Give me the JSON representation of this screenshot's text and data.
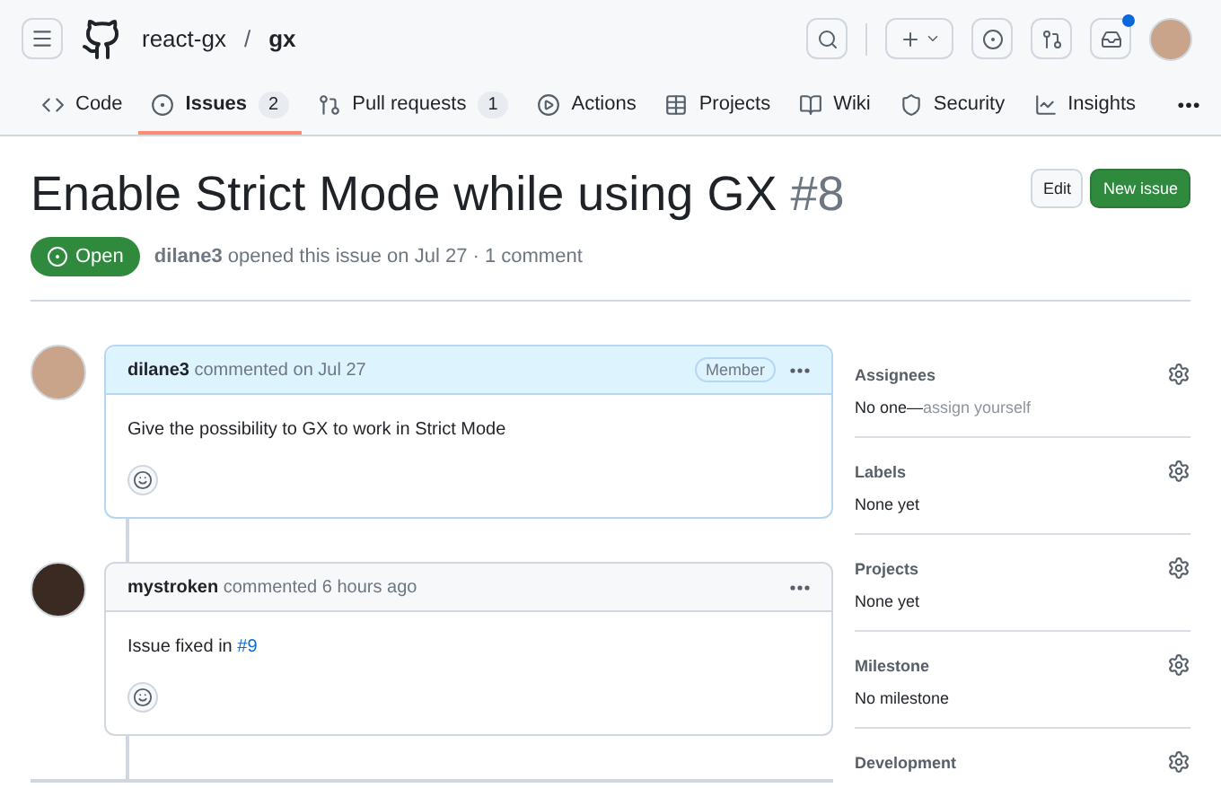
{
  "header": {
    "owner": "react-gx",
    "separator": "/",
    "repo": "gx",
    "unread_notifications": true
  },
  "tabs": [
    {
      "label": "Code",
      "selected": false
    },
    {
      "label": "Issues",
      "count": "2",
      "selected": true
    },
    {
      "label": "Pull requests",
      "count": "1",
      "selected": false
    },
    {
      "label": "Actions",
      "selected": false
    },
    {
      "label": "Projects",
      "selected": false
    },
    {
      "label": "Wiki",
      "selected": false
    },
    {
      "label": "Security",
      "selected": false
    },
    {
      "label": "Insights",
      "selected": false
    }
  ],
  "issue": {
    "title": "Enable Strict Mode while using GX",
    "number": "#8",
    "state": "Open",
    "author": "dilane3",
    "meta": "opened this issue on Jul 27 · 1 comment",
    "buttons": [
      "Edit",
      "New issue"
    ]
  },
  "comments": [
    {
      "author": "dilane3",
      "action": "commented on Jul 27",
      "association": "Member",
      "highlighted": true,
      "body": "Give the possibility to GX to work in Strict Mode"
    },
    {
      "author": "mystroken",
      "action": "commented 6 hours ago",
      "highlighted": false,
      "body": "Issue fixed in",
      "link": "#9"
    }
  ],
  "sidebar": [
    {
      "title": "Assignees",
      "value": "No one—",
      "hint": "assign yourself"
    },
    {
      "title": "Labels",
      "value": "None yet"
    },
    {
      "title": "Projects",
      "value": "None yet"
    },
    {
      "title": "Milestone",
      "value": "No milestone"
    },
    {
      "title": "Development"
    }
  ]
}
